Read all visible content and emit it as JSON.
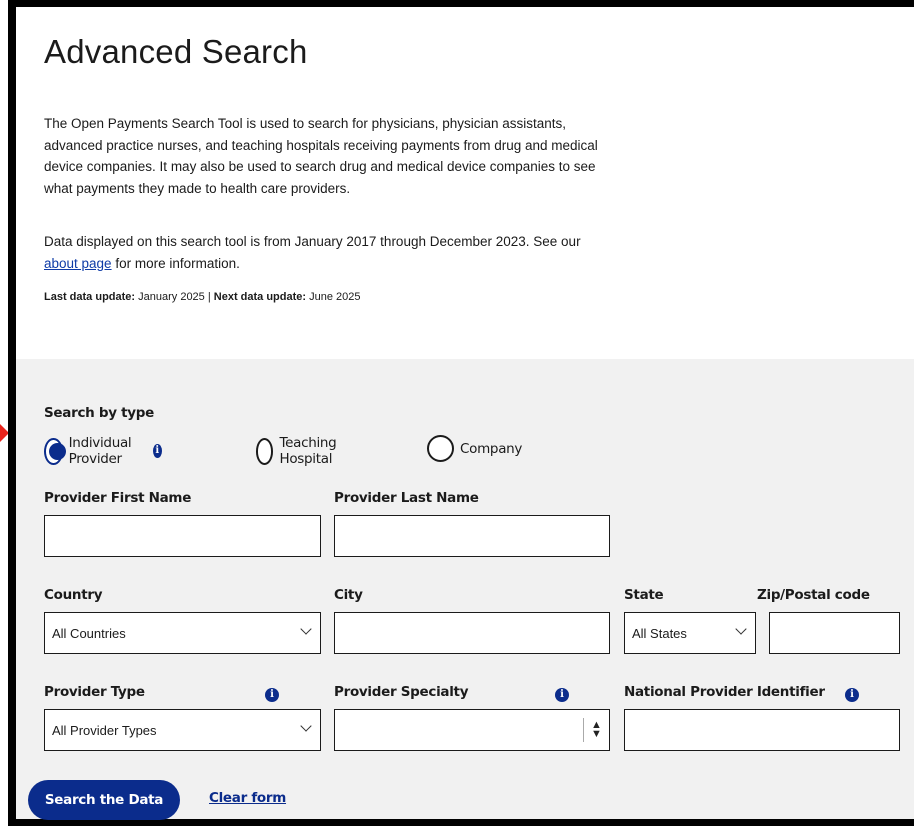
{
  "page": {
    "title": "Advanced Search",
    "intro": "The Open Payments Search Tool is used to search for physicians, physician assistants, advanced practice nurses, and teaching hospitals receiving payments from drug and medical device companies. It may also be used to search drug and medical device companies to see what payments they made to health care providers.",
    "data_range": "Data displayed on this search tool is from January 2017 through December 2023. See our",
    "about_link": "about page",
    "data_range_tail": " for more information.",
    "last_update_label": "Last data update:",
    "last_update_value": " January 2025 | ",
    "next_update_label": "Next data update:",
    "next_update_value": " June 2025"
  },
  "form": {
    "search_by_type_label": "Search by type",
    "types": [
      {
        "label": "Individual Provider",
        "selected": true
      },
      {
        "label": "Teaching Hospital",
        "selected": false
      },
      {
        "label": "Company",
        "selected": false
      }
    ],
    "first_name_label": "Provider First Name",
    "last_name_label": "Provider Last Name",
    "country_label": "Country",
    "country_value": "All Countries",
    "city_label": "City",
    "state_label": "State",
    "state_value": "All States",
    "zip_label": "Zip/Postal code",
    "provider_type_label": "Provider Type",
    "provider_type_value": "All Provider Types",
    "provider_specialty_label": "Provider Specialty",
    "provider_specialty_value": "",
    "npi_label": "National Provider Identifier",
    "info_glyph": "i",
    "search_button": "Search the Data",
    "clear_link": "Clear form"
  },
  "colors": {
    "accent": "#0b2c8c",
    "panel_bg": "#f1f1f1",
    "marker": "#e8231b"
  }
}
